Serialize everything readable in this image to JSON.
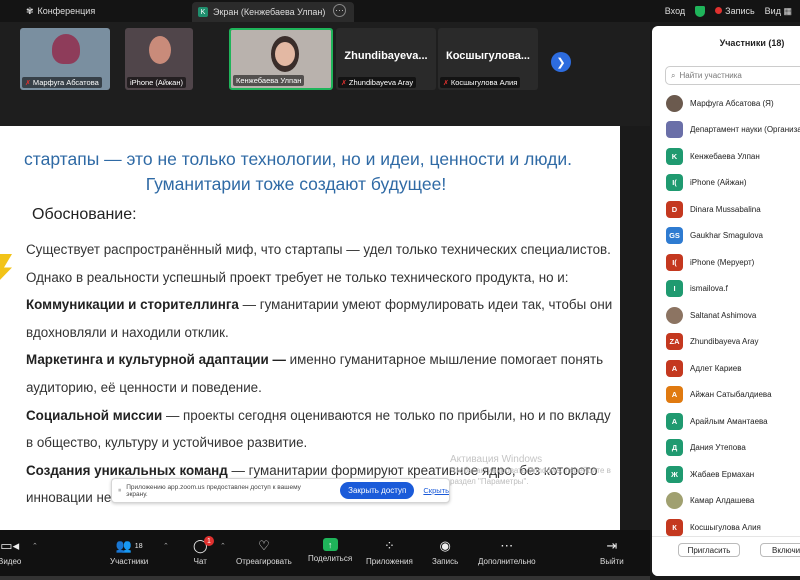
{
  "topbar": {
    "conference_label": "Конференция",
    "screen_tab_label": "Экран (Кенжебаева Улпан)",
    "tab_icon_letter": "K",
    "login_label": "Вход",
    "recording_label": "Запись",
    "view_label": "Вид"
  },
  "video_strip": [
    {
      "name": "Марфуга Абсатова",
      "muted": true,
      "kind": "video",
      "bg": "#7a8fa0"
    },
    {
      "name": "iPhone (Айжан)",
      "muted": false,
      "kind": "video",
      "bg": "#50454a"
    },
    {
      "name": "Кенжебаева Улпан",
      "muted": false,
      "kind": "video",
      "bg": "#b9b2ad"
    },
    {
      "name": "Zhundibayeva Aray",
      "big": "Zhundibayeva...",
      "muted": true,
      "kind": "name"
    },
    {
      "name": "Косшыгулова Алия",
      "big": "Косшыгулова...",
      "muted": true,
      "kind": "name"
    }
  ],
  "slide": {
    "heading_line1": "стартапы — это не только технологии, но и идеи, ценности и люди.",
    "heading_line2": "Гуманитарии тоже создают будущее!",
    "subheading": "Обоснование:",
    "p1": "Существует распространённый миф, что стартапы — удел только технических специалистов.",
    "p2": "Однако в реальности успешный проект требует не только технического продукта, но и:",
    "item1_bold": "Коммуникации и сторителлинга",
    "item1_rest": " — гуманитарии умеют формулировать идеи так, чтобы они",
    "item1_cont": "вдохновляли и находили отклик.",
    "item2_bold": "Маркетинга и культурной адаптации —",
    "item2_rest": " именно гуманитарное мышление помогает понять",
    "item2_cont": "аудиторию, её ценности и поведение.",
    "item3_bold": "Социальной миссии",
    "item3_rest": " — проекты сегодня оцениваются не только по прибыли, но и по вкладу",
    "item3_cont": "в общество, культуру и устойчивое развитие.",
    "item4_bold": "Создания уникальных команд",
    "item4_rest": " — гуманитарии формируют креативное ядро, без которого",
    "item4_cont": "инновации не",
    "watermark_title": "Активация Windows",
    "watermark_line1": "Чтобы активировать Windows, перейдите в",
    "watermark_line2": "раздел \"Параметры\"."
  },
  "toast": {
    "text": "Приложению app.zoom.us предоставлен доступ к вашему экрану.",
    "button": "Закрыть доступ",
    "hide": "Скрыть"
  },
  "toolbar": {
    "video": "Видео",
    "participants": "Участники",
    "participants_count": "18",
    "chat": "Чат",
    "chat_badge": "1",
    "react": "Отреагировать",
    "share": "Поделиться",
    "apps": "Приложения",
    "record": "Запись",
    "more": "Дополнительно",
    "leave": "Выйти"
  },
  "panel": {
    "title": "Участники (18)",
    "search_placeholder": "Найти участника",
    "participants": [
      {
        "name": "Марфуга Абсатова (Я)",
        "initials": "",
        "color": "#6b5a4e",
        "photo": true
      },
      {
        "name": "Департамент науки (Организатор)",
        "initials": "",
        "color": "#6a6fa8",
        "photo": false
      },
      {
        "name": "Кенжебаева Улпан",
        "initials": "K",
        "color": "#1f9a70",
        "photo": false
      },
      {
        "name": "iPhone (Айжан)",
        "initials": "I(",
        "color": "#1f9a70",
        "photo": false
      },
      {
        "name": "Dinara Mussabalina",
        "initials": "D",
        "color": "#c4381f",
        "photo": false
      },
      {
        "name": "Gaukhar Smagulova",
        "initials": "GS",
        "color": "#2e7bd1",
        "photo": false
      },
      {
        "name": "iPhone (Меруерт)",
        "initials": "I(",
        "color": "#c4381f",
        "photo": false
      },
      {
        "name": "ismailova.f",
        "initials": "I",
        "color": "#1f9a70",
        "photo": false
      },
      {
        "name": "Saltanat Ashimova",
        "initials": "",
        "color": "#8c7462",
        "photo": true
      },
      {
        "name": "Zhundibayeva Aray",
        "initials": "ZA",
        "color": "#c4381f",
        "photo": false
      },
      {
        "name": "Адлет Кариев",
        "initials": "A",
        "color": "#c4381f",
        "photo": false
      },
      {
        "name": "Айжан Сатыбалдиева",
        "initials": "A",
        "color": "#e07a10",
        "photo": false
      },
      {
        "name": "Арайлым Амантаева",
        "initials": "A",
        "color": "#1f9a70",
        "photo": false
      },
      {
        "name": "Дания Утепова",
        "initials": "Д",
        "color": "#1f9a70",
        "photo": false
      },
      {
        "name": "Жабаев Ермахан",
        "initials": "Ж",
        "color": "#1f9a70",
        "photo": false
      },
      {
        "name": "Камар Алдашева",
        "initials": "",
        "color": "#a0a070",
        "photo": true
      },
      {
        "name": "Косшыгулова Алия",
        "initials": "К",
        "color": "#c4381f",
        "photo": false
      }
    ],
    "invite_button": "Пригласить",
    "mute_all_button": "Включить"
  }
}
